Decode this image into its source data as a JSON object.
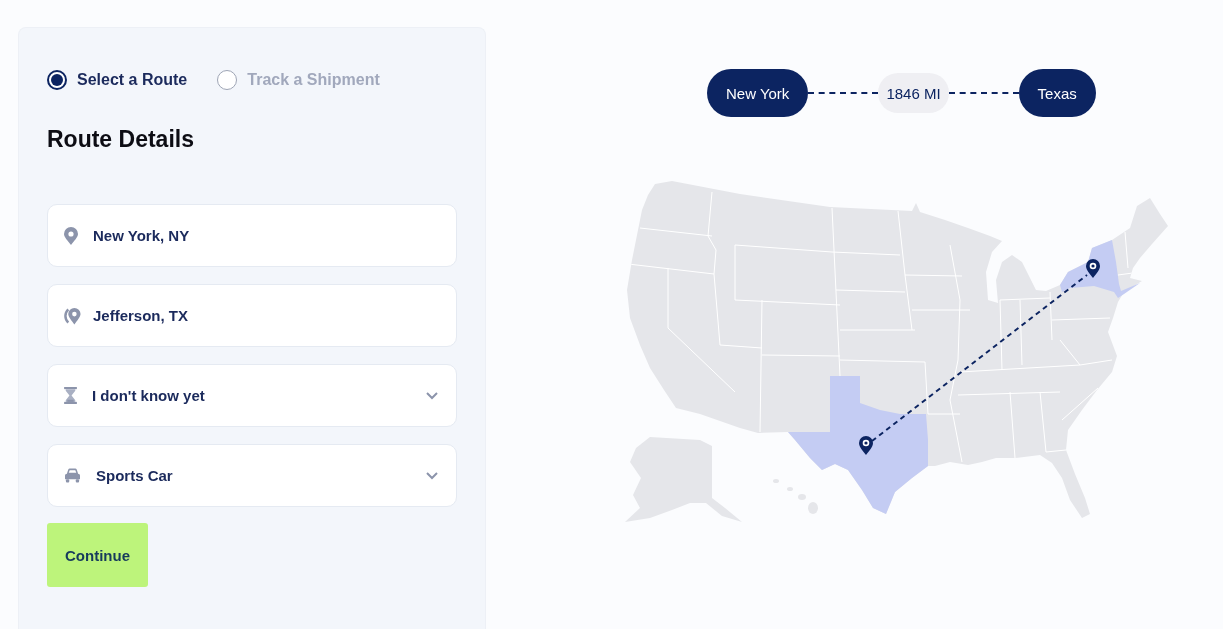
{
  "route_modes": [
    {
      "label": "Select a Route",
      "selected": true
    },
    {
      "label": "Track a Shipment",
      "selected": false
    }
  ],
  "route_details": {
    "title": "Route Details",
    "fields": [
      {
        "kind": "input",
        "value": "New York, NY"
      },
      {
        "kind": "input",
        "value": "Jefferson, TX"
      },
      {
        "kind": "select",
        "value": "I don't know yet"
      },
      {
        "kind": "select",
        "value": "Sports Car"
      }
    ],
    "button": "Continue"
  },
  "route_summary": {
    "origin": "New York",
    "distance": "1846 MI",
    "destination": "Texas"
  }
}
